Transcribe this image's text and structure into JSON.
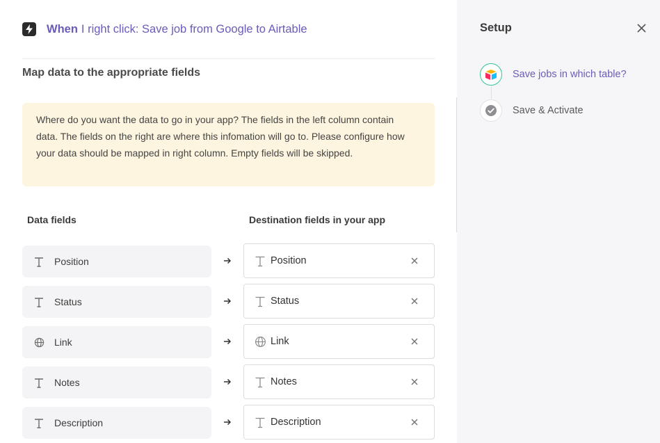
{
  "header": {
    "when_label": "When",
    "title_rest": "I right click: Save job from Google to Airtable"
  },
  "section_title": "Map data to the appropriate fields",
  "notice": "Where do you want the data to go in your app? The fields in the left column contain data. The fields on the right are where this infomation will go to. Please configure how your data should be mapped in right column. Empty fields will be skipped.",
  "columns": {
    "left": "Data fields",
    "right": "Destination fields in your app"
  },
  "mappings": [
    {
      "source": "Position",
      "destination": "Position",
      "icon": "text-icon"
    },
    {
      "source": "Status",
      "destination": "Status",
      "icon": "text-icon"
    },
    {
      "source": "Link",
      "destination": "Link",
      "icon": "globe-icon"
    },
    {
      "source": "Notes",
      "destination": "Notes",
      "icon": "text-icon"
    },
    {
      "source": "Description",
      "destination": "Description",
      "icon": "text-icon"
    }
  ],
  "sidebar": {
    "title": "Setup",
    "steps": [
      {
        "label": "Save jobs in which table?",
        "state": "active",
        "icon": "airtable-logo-icon"
      },
      {
        "label": "Save & Activate",
        "state": "pending",
        "icon": "check-circle-icon"
      }
    ]
  },
  "colors": {
    "accent": "#6b5bb8",
    "notice_bg": "#fdf5df",
    "active_ring": "#34c19a",
    "sidebar_bg": "#f6f6f8"
  }
}
